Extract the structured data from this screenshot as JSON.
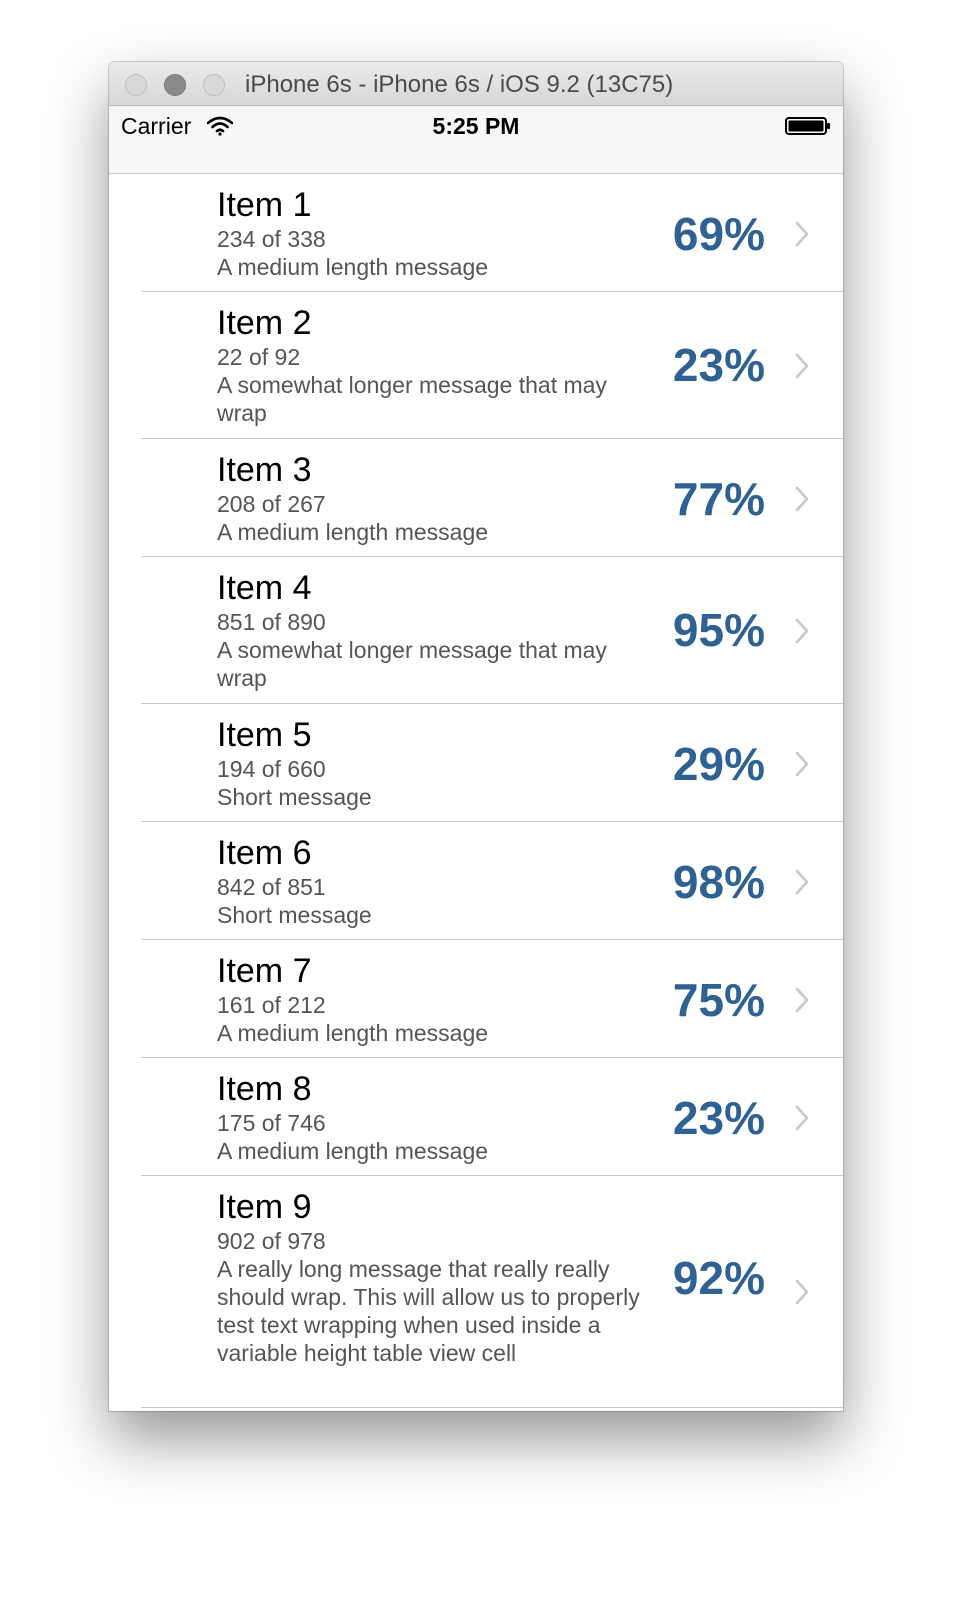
{
  "window": {
    "title": "iPhone 6s - iPhone 6s / iOS 9.2 (13C75)"
  },
  "status_bar": {
    "carrier": "Carrier",
    "time": "5:25 PM",
    "wifi_icon": "wifi-icon",
    "battery_icon": "battery-icon"
  },
  "colors": {
    "accent": "#2f6293",
    "separator": "#c8c8cc",
    "secondary_text": "#555555"
  },
  "items": [
    {
      "title": "Item 1",
      "count": "234 of 338",
      "message": "A medium length message",
      "percent": "69%"
    },
    {
      "title": "Item 2",
      "count": "22 of 92",
      "message": "A somewhat longer message that may wrap",
      "percent": "23%"
    },
    {
      "title": "Item 3",
      "count": "208 of 267",
      "message": "A medium length message",
      "percent": "77%"
    },
    {
      "title": "Item 4",
      "count": "851 of 890",
      "message": "A somewhat longer message that may wrap",
      "percent": "95%"
    },
    {
      "title": "Item 5",
      "count": "194 of 660",
      "message": "Short message",
      "percent": "29%"
    },
    {
      "title": "Item 6",
      "count": "842 of 851",
      "message": "Short message",
      "percent": "98%"
    },
    {
      "title": "Item 7",
      "count": "161 of 212",
      "message": "A medium length message",
      "percent": "75%"
    },
    {
      "title": "Item 8",
      "count": "175 of 746",
      "message": "A medium length message",
      "percent": "23%"
    },
    {
      "title": "Item 9",
      "count": "902 of 978",
      "message": "A really long message that really really should wrap.  This will allow us to properly test text wrapping when used inside a variable height table view cell",
      "percent": "92%"
    }
  ]
}
